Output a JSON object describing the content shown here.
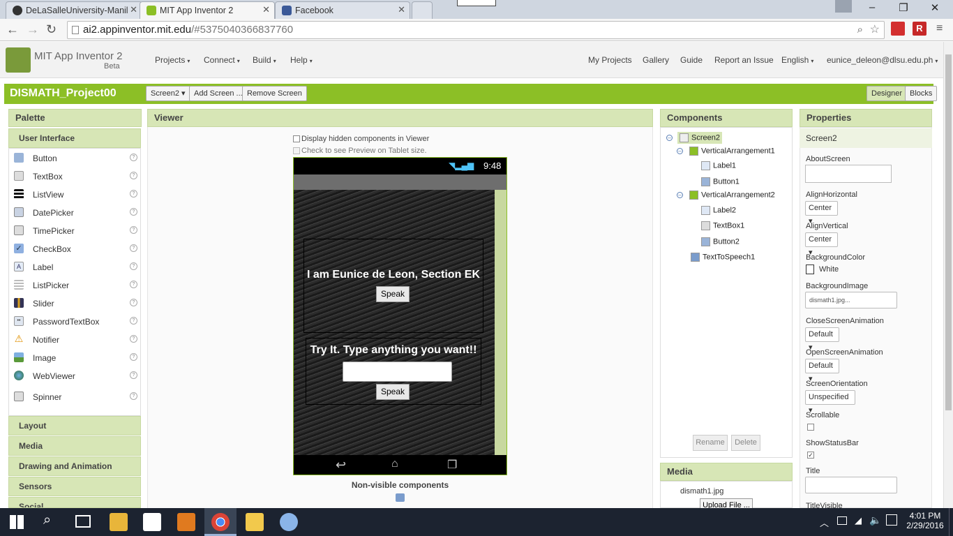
{
  "browser": {
    "tabs": [
      {
        "title": "DeLaSalleUniversity-Manil"
      },
      {
        "title": "MIT App Inventor 2"
      },
      {
        "title": "Facebook"
      }
    ],
    "url_domain": "ai2.appinventor.mit.edu",
    "url_hash": "/#5375040366837760"
  },
  "header": {
    "app_name": "MIT App Inventor 2",
    "app_badge": "Beta",
    "menus": [
      "Projects",
      "Connect",
      "Build",
      "Help"
    ],
    "links": [
      "My Projects",
      "Gallery",
      "Guide",
      "Report an Issue",
      "English",
      "eunice_deleon@dlsu.edu.ph"
    ]
  },
  "project": {
    "name": "DISMATH_Project00",
    "screen_dropdown": "Screen2",
    "add_screen": "Add Screen ...",
    "remove_screen": "Remove Screen",
    "designer": "Designer",
    "blocks": "Blocks"
  },
  "palette": {
    "title": "Palette",
    "category": "User Interface",
    "items": [
      "Button",
      "TextBox",
      "ListView",
      "DatePicker",
      "TimePicker",
      "CheckBox",
      "Label",
      "ListPicker",
      "Slider",
      "PasswordTextBox",
      "Notifier",
      "Image",
      "WebViewer",
      "Spinner"
    ],
    "categories": [
      "Layout",
      "Media",
      "Drawing and Animation",
      "Sensors",
      "Social"
    ]
  },
  "viewer": {
    "title": "Viewer",
    "hidden_check": "Display hidden components in Viewer",
    "tablet_check": "Check to see Preview on Tablet size.",
    "time": "9:48",
    "label1": "I am Eunice de Leon, Section EK",
    "button1": "Speak",
    "label2": "Try It. Type anything you want!!",
    "button2": "Speak",
    "nonvisible": "Non-visible components"
  },
  "components": {
    "title": "Components",
    "screen": "Screen2",
    "va1": "VerticalArrangement1",
    "label1": "Label1",
    "button1": "Button1",
    "va2": "VerticalArrangement2",
    "label2": "Label2",
    "textbox1": "TextBox1",
    "button2": "Button2",
    "tts": "TextToSpeech1",
    "rename": "Rename",
    "delete": "Delete"
  },
  "media": {
    "title": "Media",
    "file": "dismath1.jpg",
    "upload": "Upload File ..."
  },
  "properties": {
    "title": "Properties",
    "screen": "Screen2",
    "about": "AboutScreen",
    "align_h": "AlignHorizontal",
    "align_h_val": "Center",
    "align_v": "AlignVertical",
    "align_v_val": "Center",
    "bg_color": "BackgroundColor",
    "bg_color_val": "White",
    "bg_image": "BackgroundImage",
    "bg_image_val": "dismath1.jpg...",
    "close_anim": "CloseScreenAnimation",
    "close_anim_val": "Default",
    "open_anim": "OpenScreenAnimation",
    "open_anim_val": "Default",
    "orientation": "ScreenOrientation",
    "orientation_val": "Unspecified",
    "scrollable": "Scrollable",
    "status_bar": "ShowStatusBar",
    "title_prop": "Title",
    "title_visible": "TitleVisible"
  },
  "taskbar": {
    "time": "4:01 PM",
    "date": "2/29/2016"
  },
  "colors": {
    "accent_green": "#8cbf26",
    "panel_head": "#d7e6b6"
  }
}
